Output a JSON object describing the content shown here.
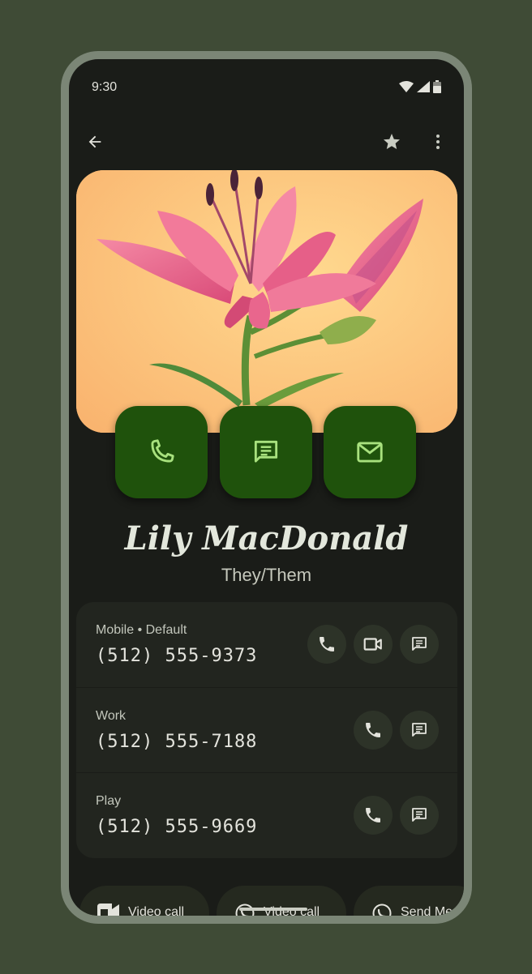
{
  "status_bar": {
    "time": "9:30"
  },
  "app_bar": {
    "back_icon": "arrow-back-icon",
    "favorite_icon": "star-icon",
    "more_icon": "more-vert-icon"
  },
  "hero": {
    "description_icon": "lily-photo"
  },
  "quick_actions": [
    {
      "icon": "phone-icon"
    },
    {
      "icon": "message-icon"
    },
    {
      "icon": "mail-icon"
    }
  ],
  "contact": {
    "name": "Lily MacDonald",
    "pronouns": "They/Them"
  },
  "numbers": [
    {
      "label": "Mobile • Default",
      "number": "(512) 555-9373",
      "actions": [
        "phone-icon",
        "video-icon",
        "message-icon"
      ]
    },
    {
      "label": "Work",
      "number": "(512) 555-7188",
      "actions": [
        "phone-icon",
        "message-icon"
      ]
    },
    {
      "label": "Play",
      "number": "(512) 555-9669",
      "actions": [
        "phone-icon",
        "message-icon"
      ]
    }
  ],
  "chips": [
    {
      "label": "Video call",
      "icon": "meet-icon"
    },
    {
      "label": "Video call",
      "icon": "whatsapp-icon"
    },
    {
      "label": "Send Mes",
      "icon": "whatsapp-icon"
    }
  ],
  "colors": {
    "background": "#3f4b36",
    "screen": "#1a1c18",
    "accent_container": "#1f520c",
    "accent_icon": "#a8e17e"
  }
}
